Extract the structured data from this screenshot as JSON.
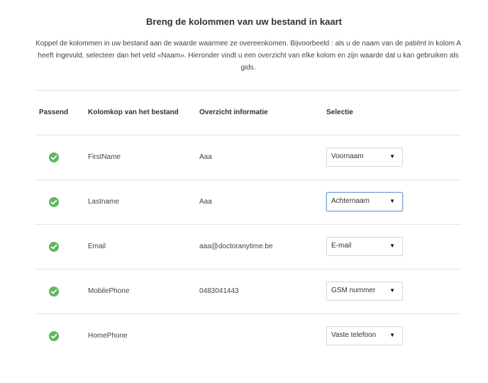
{
  "page": {
    "title": "Breng de kolommen van uw bestand in kaart",
    "description": "Koppel de kolommen in uw bestand aan de waarde waarmee ze overeenkomen. Bijvoorbeeld : als u de naam van de patiënt in kolom A heeft ingevuld, selecteer dan het veld «Naam». Hieronder vindt u een overzicht van elke kolom en zijn waarde dat u kan gebruiken als gids."
  },
  "table": {
    "headers": {
      "match": "Passend",
      "column": "Kolomkop van het bestand",
      "overview": "Overzicht informatie",
      "selection": "Selectie"
    },
    "rows": [
      {
        "column": "FirstName",
        "overview": "Aaa",
        "selection": "Voornaam",
        "focused": false
      },
      {
        "column": "Lastname",
        "overview": "Aaa",
        "selection": "Achternaam",
        "focused": true
      },
      {
        "column": "Email",
        "overview": "aaa@doctoranytime.be",
        "selection": "E-mail",
        "focused": false
      },
      {
        "column": "MobilePhone",
        "overview": "0483041443",
        "selection": "GSM nummer",
        "focused": false
      },
      {
        "column": "HomePhone",
        "overview": "",
        "selection": "Vaste telefoon",
        "focused": false
      }
    ]
  },
  "icons": {
    "match": "check-circle-icon",
    "dropdown": "triangle-down-icon"
  },
  "colors": {
    "check": "#5cb85c",
    "focus_border": "#7aa3d6"
  },
  "glyphs": {
    "arrow": "▼"
  }
}
